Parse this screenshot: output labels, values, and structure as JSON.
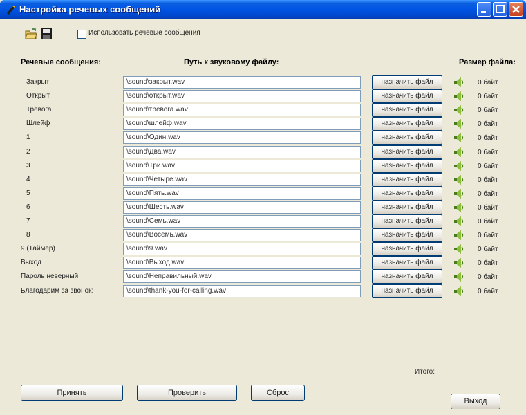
{
  "window": {
    "title": "Настройка речевых сообщений"
  },
  "toolbar": {
    "open_icon": "open-folder-icon",
    "save_icon": "save-disk-icon",
    "use_voice_label": "Использовать речевые сообщения",
    "use_voice_checked": false
  },
  "headers": {
    "messages": "Речевые сообщения:",
    "path": "Путь к звуковому файлу:",
    "size": "Размер файла:"
  },
  "rows": [
    {
      "label": "Закрыт",
      "path": "\\sound\\закрыт.wav",
      "button": "назначить файл",
      "size": "0 байт"
    },
    {
      "label": "Открыт",
      "path": "\\sound\\открыт.wav",
      "button": "назначить файл",
      "size": "0 байт"
    },
    {
      "label": "Тревога",
      "path": "\\sound\\тревога.wav",
      "button": "назначить файл",
      "size": "0 байт"
    },
    {
      "label": "Шлейф",
      "path": "\\sound\\шлейф.wav",
      "button": "назначить файл",
      "size": "0 байт"
    },
    {
      "label": "1",
      "path": "\\sound\\Один.wav",
      "button": "назначить файл",
      "size": "0 байт"
    },
    {
      "label": "2",
      "path": "\\sound\\Два.wav",
      "button": "назначить файл",
      "size": "0 байт"
    },
    {
      "label": "3",
      "path": "\\sound\\Три.wav",
      "button": "назначить файл",
      "size": "0 байт"
    },
    {
      "label": "4",
      "path": "\\sound\\Четыре.wav",
      "button": "назначить файл",
      "size": "0 байт"
    },
    {
      "label": "5",
      "path": "\\sound\\Пять.wav",
      "button": "назначить файл",
      "size": "0 байт"
    },
    {
      "label": "6",
      "path": "\\sound\\Шесть.wav",
      "button": "назначить файл",
      "size": "0 байт"
    },
    {
      "label": "7",
      "path": "\\sound\\Семь.wav",
      "button": "назначить файл",
      "size": "0 байт"
    },
    {
      "label": "8",
      "path": "\\sound\\Восемь.wav",
      "button": "назначить файл",
      "size": "0 байт"
    },
    {
      "label": "9 (Таймер)",
      "path": "\\sound\\9.wav",
      "button": "назначить файл",
      "size": "0 байт"
    },
    {
      "label": "Выход",
      "path": "\\sound\\Выход.wav",
      "button": "назначить файл",
      "size": "0 байт"
    },
    {
      "label": "Пароль неверный",
      "path": "\\sound\\Неправильный.wav",
      "button": "назначить файл",
      "size": "0 байт"
    },
    {
      "label": "Благодарим за звонок:",
      "path": "\\sound\\thank-you-for-calling.wav",
      "button": "назначить файл",
      "size": "0 байт"
    }
  ],
  "total_label": "Итого:",
  "buttons": {
    "apply": "Принять",
    "check": "Проверить",
    "reset": "Сброс",
    "exit": "Выход"
  },
  "colors": {
    "titlebar": "#0054e3",
    "window_bg": "#ece9d8"
  }
}
